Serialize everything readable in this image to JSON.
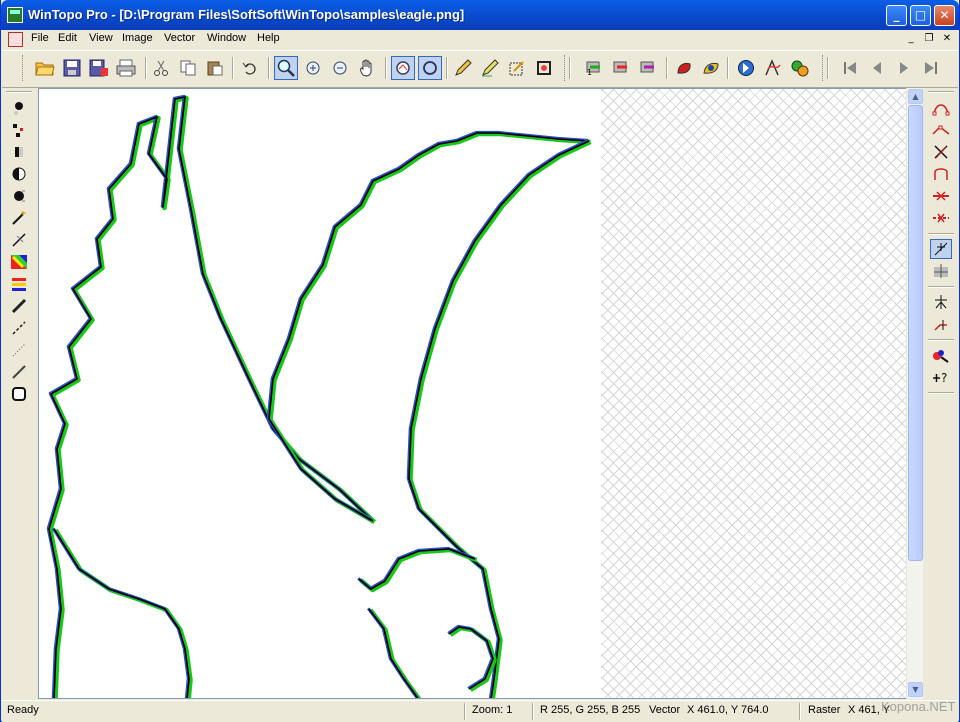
{
  "window": {
    "title": "WinTopo Pro - [D:\\Program Files\\SoftSoft\\WinTopo\\samples\\eagle.png]"
  },
  "titlebar_buttons": {
    "minimize": "_",
    "maximize": "□",
    "close": "✕"
  },
  "menu": {
    "items": [
      "File",
      "Edit",
      "View",
      "Image",
      "Vector",
      "Window",
      "Help"
    ]
  },
  "mdi_buttons": {
    "minimize": "_",
    "restore": "❐",
    "close": "✕"
  },
  "toolbar": {
    "tools": [
      "open-folder-icon",
      "save-icon",
      "save-as-icon",
      "print-icon",
      "cut-icon",
      "copy-icon",
      "paste-icon",
      "undo-icon",
      "zoom-icon",
      "zoom-in-icon",
      "zoom-out-icon",
      "pan-hand-icon",
      "view-raster-icon",
      "view-vector-icon",
      "pencil-icon",
      "eraser-icon",
      "select-area-icon",
      "crop-icon",
      "layer-red-icon",
      "layer-green-icon",
      "layer-purple-icon",
      "color-fill-icon",
      "color-swap-icon",
      "globe-icon",
      "transform-icon",
      "batch-icon",
      "first-page-icon",
      "prev-page-icon",
      "next-page-icon",
      "last-page-icon"
    ]
  },
  "colors": {
    "title_blue": "#0a5fe6",
    "chrome": "#ece9d8",
    "outline_green": "#18c818",
    "outline_blue": "#2a4fc8",
    "outline_black": "#000000"
  },
  "status": {
    "ready": "Ready",
    "zoom": "Zoom: 1",
    "rgb": "R 255, G 255, B 255",
    "vector_label": "Vector",
    "vector_coords": "X 461.0, Y 764.0",
    "raster_label": "Raster",
    "raster_coords": "X 461, Y"
  },
  "watermark": "Kopona.NET"
}
